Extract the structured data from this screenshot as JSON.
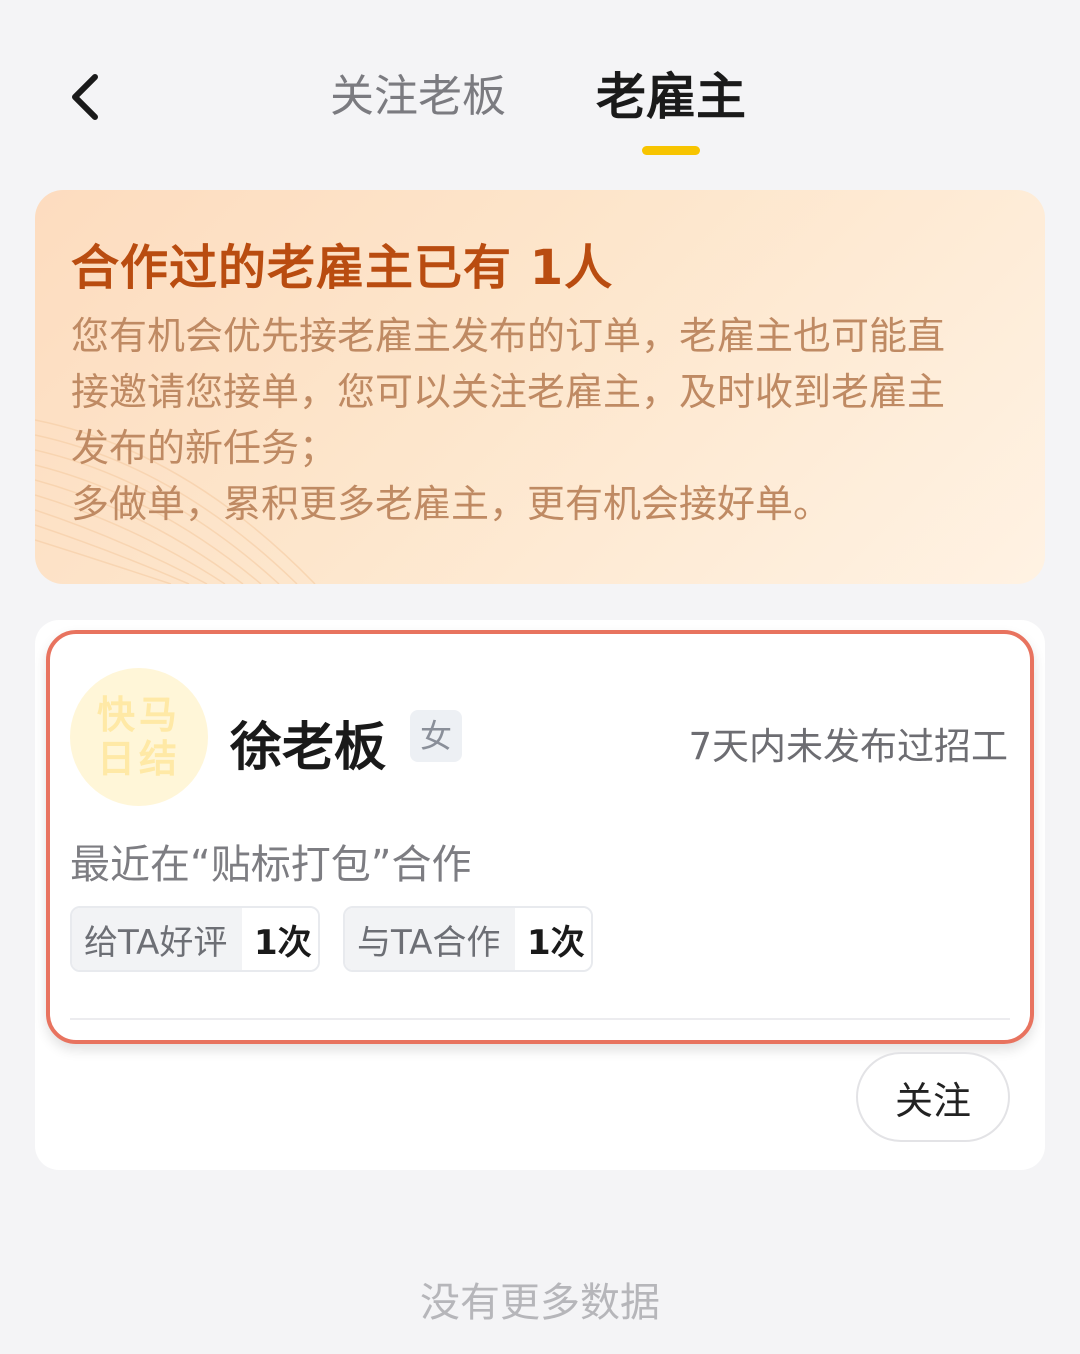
{
  "header": {
    "back_icon": "chevron-left-icon",
    "tabs": [
      {
        "label": "关注老板",
        "active": false
      },
      {
        "label": "老雇主",
        "active": true
      }
    ],
    "active_indicator_color": "#f7c400"
  },
  "banner": {
    "title": "合作过的老雇主已有 1人",
    "description_lines": [
      "您有机会优先接老雇主发布的订单，老雇主也可能直",
      "接邀请您接单，您可以关注老雇主，及时收到老雇主",
      "发布的新任务；",
      "多做单，累积更多老雇主，更有机会接好单。"
    ],
    "title_color": "#b94c10"
  },
  "employer": {
    "avatar_text": [
      "快马",
      "日结"
    ],
    "name": "徐老板",
    "gender": "女",
    "status": "7天内未发布过招工",
    "recent": "最近在“贴标打包”合作",
    "stats": [
      {
        "label": "给TA好评",
        "value": "1次"
      },
      {
        "label": "与TA合作",
        "value": "1次"
      }
    ],
    "follow_label": "关注",
    "highlight_color": "#e8735f"
  },
  "footer": {
    "no_more_text": "没有更多数据"
  }
}
